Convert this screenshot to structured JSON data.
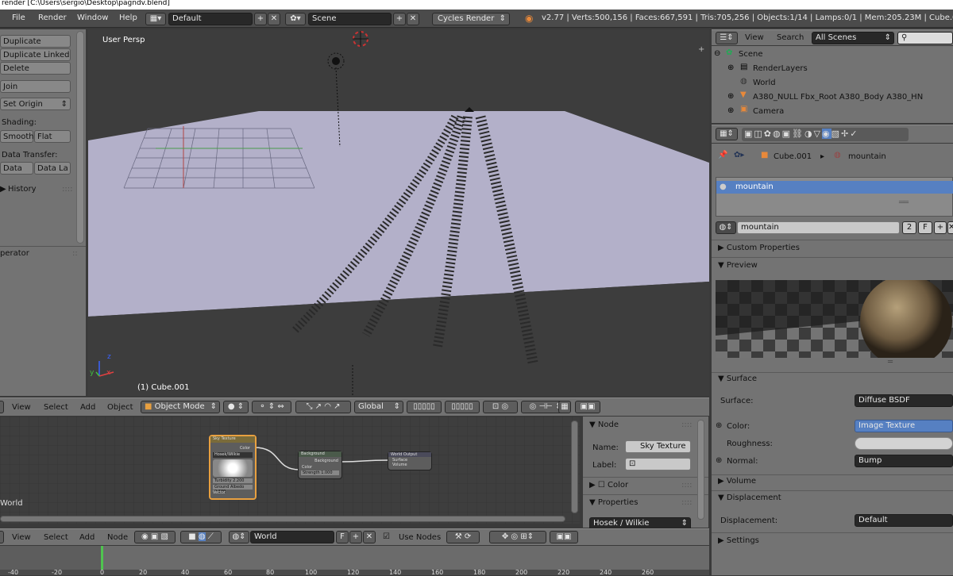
{
  "title": "render [C:\\Users\\sergio\\Desktop\\pagndv.blend]",
  "menu": [
    "File",
    "Render",
    "Window",
    "Help"
  ],
  "header": {
    "layout": "Default",
    "scene": "Scene",
    "engine": "Cycles Render",
    "stats": "v2.77 | Verts:500,156 | Faces:667,591 | Tris:705,256 | Objects:1/14 | Lamps:0/1 | Mem:205.23M | Cube.001"
  },
  "toolpanel": {
    "duplicate": "Duplicate",
    "duplicate_linked": "Duplicate Linked",
    "delete": "Delete",
    "join": "Join",
    "set_origin": "Set Origin",
    "shading_label": "Shading:",
    "smooth": "Smooth",
    "flat": "Flat",
    "data_transfer_label": "Data Transfer:",
    "data": "Data",
    "data_la": "Data La",
    "history": "History",
    "operator": "perator"
  },
  "viewport": {
    "label": "User Persp",
    "object_label": "(1) Cube.001",
    "axis_x": "x",
    "axis_y": "y",
    "axis_z": "z"
  },
  "view3d_header": {
    "view": "View",
    "select": "Select",
    "add": "Add",
    "object": "Object",
    "mode": "Object Mode",
    "orientation": "Global"
  },
  "outliner": {
    "view": "View",
    "search": "Search",
    "filter": "All Scenes",
    "items": [
      "Scene",
      "RenderLayers",
      "World",
      "A380_NULL Fbx_Root A380_Body A380_HN",
      "Camera"
    ]
  },
  "props": {
    "breadcrumb_obj": "Cube.001",
    "breadcrumb_mat": "mountain",
    "slot": "mountain",
    "material_name": "mountain",
    "users": "2",
    "fake": "F",
    "custom_props": "Custom Properties",
    "preview": "Preview",
    "surface_hdr": "Surface",
    "surface_label": "Surface:",
    "surface_value": "Diffuse BSDF",
    "color_label": "Color:",
    "color_value": "Image Texture",
    "roughness_label": "Roughness:",
    "normal_label": "Normal:",
    "normal_value": "Bump",
    "volume": "Volume",
    "displacement_hdr": "Displacement",
    "displacement_label": "Displacement:",
    "displacement_value": "Default",
    "settings": "Settings"
  },
  "nodes": {
    "sky": {
      "title": "Sky Texture",
      "out": "Color",
      "model": "Hosek/Wilkie",
      "turbidity": "Turbidity 2.200",
      "albedo": "Ground Albedo 0.300",
      "vector": "Vector"
    },
    "bg": {
      "title": "Background",
      "out": "Background",
      "color": "Color",
      "strength": "Strength 1.000"
    },
    "wo": {
      "title": "World Output",
      "surface": "Surface",
      "volume": "Volume"
    },
    "world_label": "World"
  },
  "node_side": {
    "node_hdr": "Node",
    "name_label": "Name:",
    "name_value": "Sky Texture",
    "label_label": "Label:",
    "color": "Color",
    "properties": "Properties",
    "model": "Hosek / Wilkie"
  },
  "node_header": {
    "view": "View",
    "select": "Select",
    "add": "Add",
    "node": "Node",
    "world": "World",
    "f": "F",
    "use_nodes": "Use Nodes"
  },
  "timeline_ticks": [
    "-40",
    "-20",
    "0",
    "20",
    "40",
    "60",
    "80",
    "100",
    "120",
    "140",
    "160",
    "180",
    "200",
    "220",
    "240",
    "260"
  ]
}
